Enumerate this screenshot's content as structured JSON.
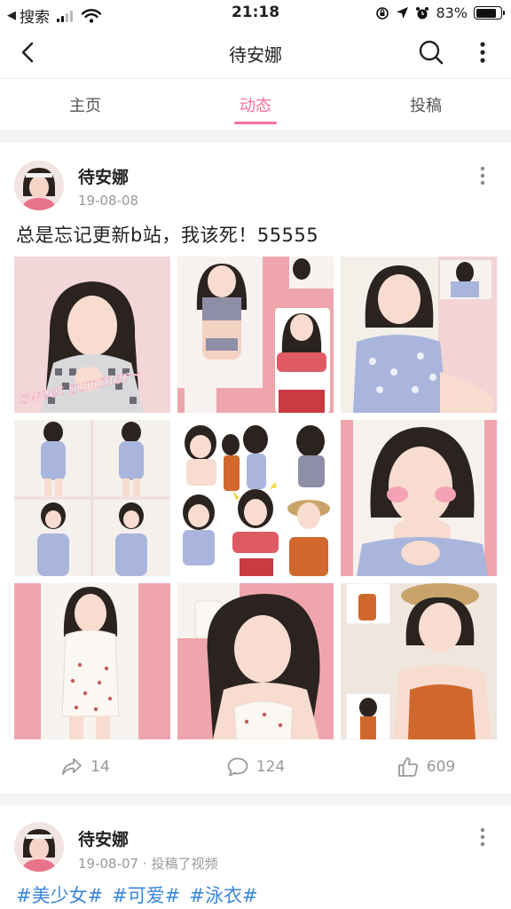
{
  "status_bar": {
    "back_app": "搜索",
    "time": "21:18",
    "battery": "83%",
    "battery_level": 0.83
  },
  "nav": {
    "title": "待安娜"
  },
  "tabs": [
    {
      "label": "主页",
      "active": false
    },
    {
      "label": "动态",
      "active": true
    },
    {
      "label": "投稿",
      "active": false
    }
  ],
  "colors": {
    "accent": "#fb7299",
    "tag": "#3b86d9",
    "meta": "#999999"
  },
  "posts": [
    {
      "author": "待安娜",
      "date": "19-08-08",
      "text": "总是忘记更新b站，我该死！55555",
      "stats": {
        "share": "14",
        "comment": "124",
        "like": "609"
      },
      "photo_overlays": {
        "sticker_text": "sweet summer~"
      }
    },
    {
      "author": "待安娜",
      "date": "19-08-07",
      "meta_sep": "·",
      "action": "投稿了视频",
      "tags": [
        "#美少女#",
        "#可爱#",
        "#泳衣#"
      ]
    }
  ]
}
